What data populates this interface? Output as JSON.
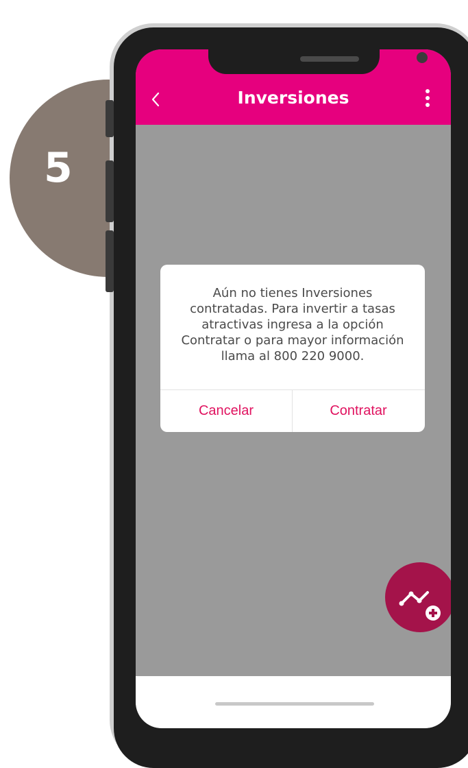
{
  "step": {
    "number": "5"
  },
  "header": {
    "title": "Inversiones",
    "back_icon": "chevron-left-icon",
    "menu_icon": "more-vertical-icon"
  },
  "dialog": {
    "message_lines": [
      "Aún no tienes Inversiones",
      "contratadas. Para invertir a tasas",
      "atractivas ingresa a la opción",
      "Contratar o para mayor información",
      "llama al 800 220 9000."
    ],
    "cancel_label": "Cancelar",
    "confirm_label": "Contratar"
  },
  "fab": {
    "icon": "trend-add-icon"
  },
  "colors": {
    "brand_pink": "#e6007e",
    "dialog_button_text": "#e0125f",
    "fab": "#a4134a",
    "step_badge": "#877a71",
    "overlay": "#9a9a9a"
  }
}
